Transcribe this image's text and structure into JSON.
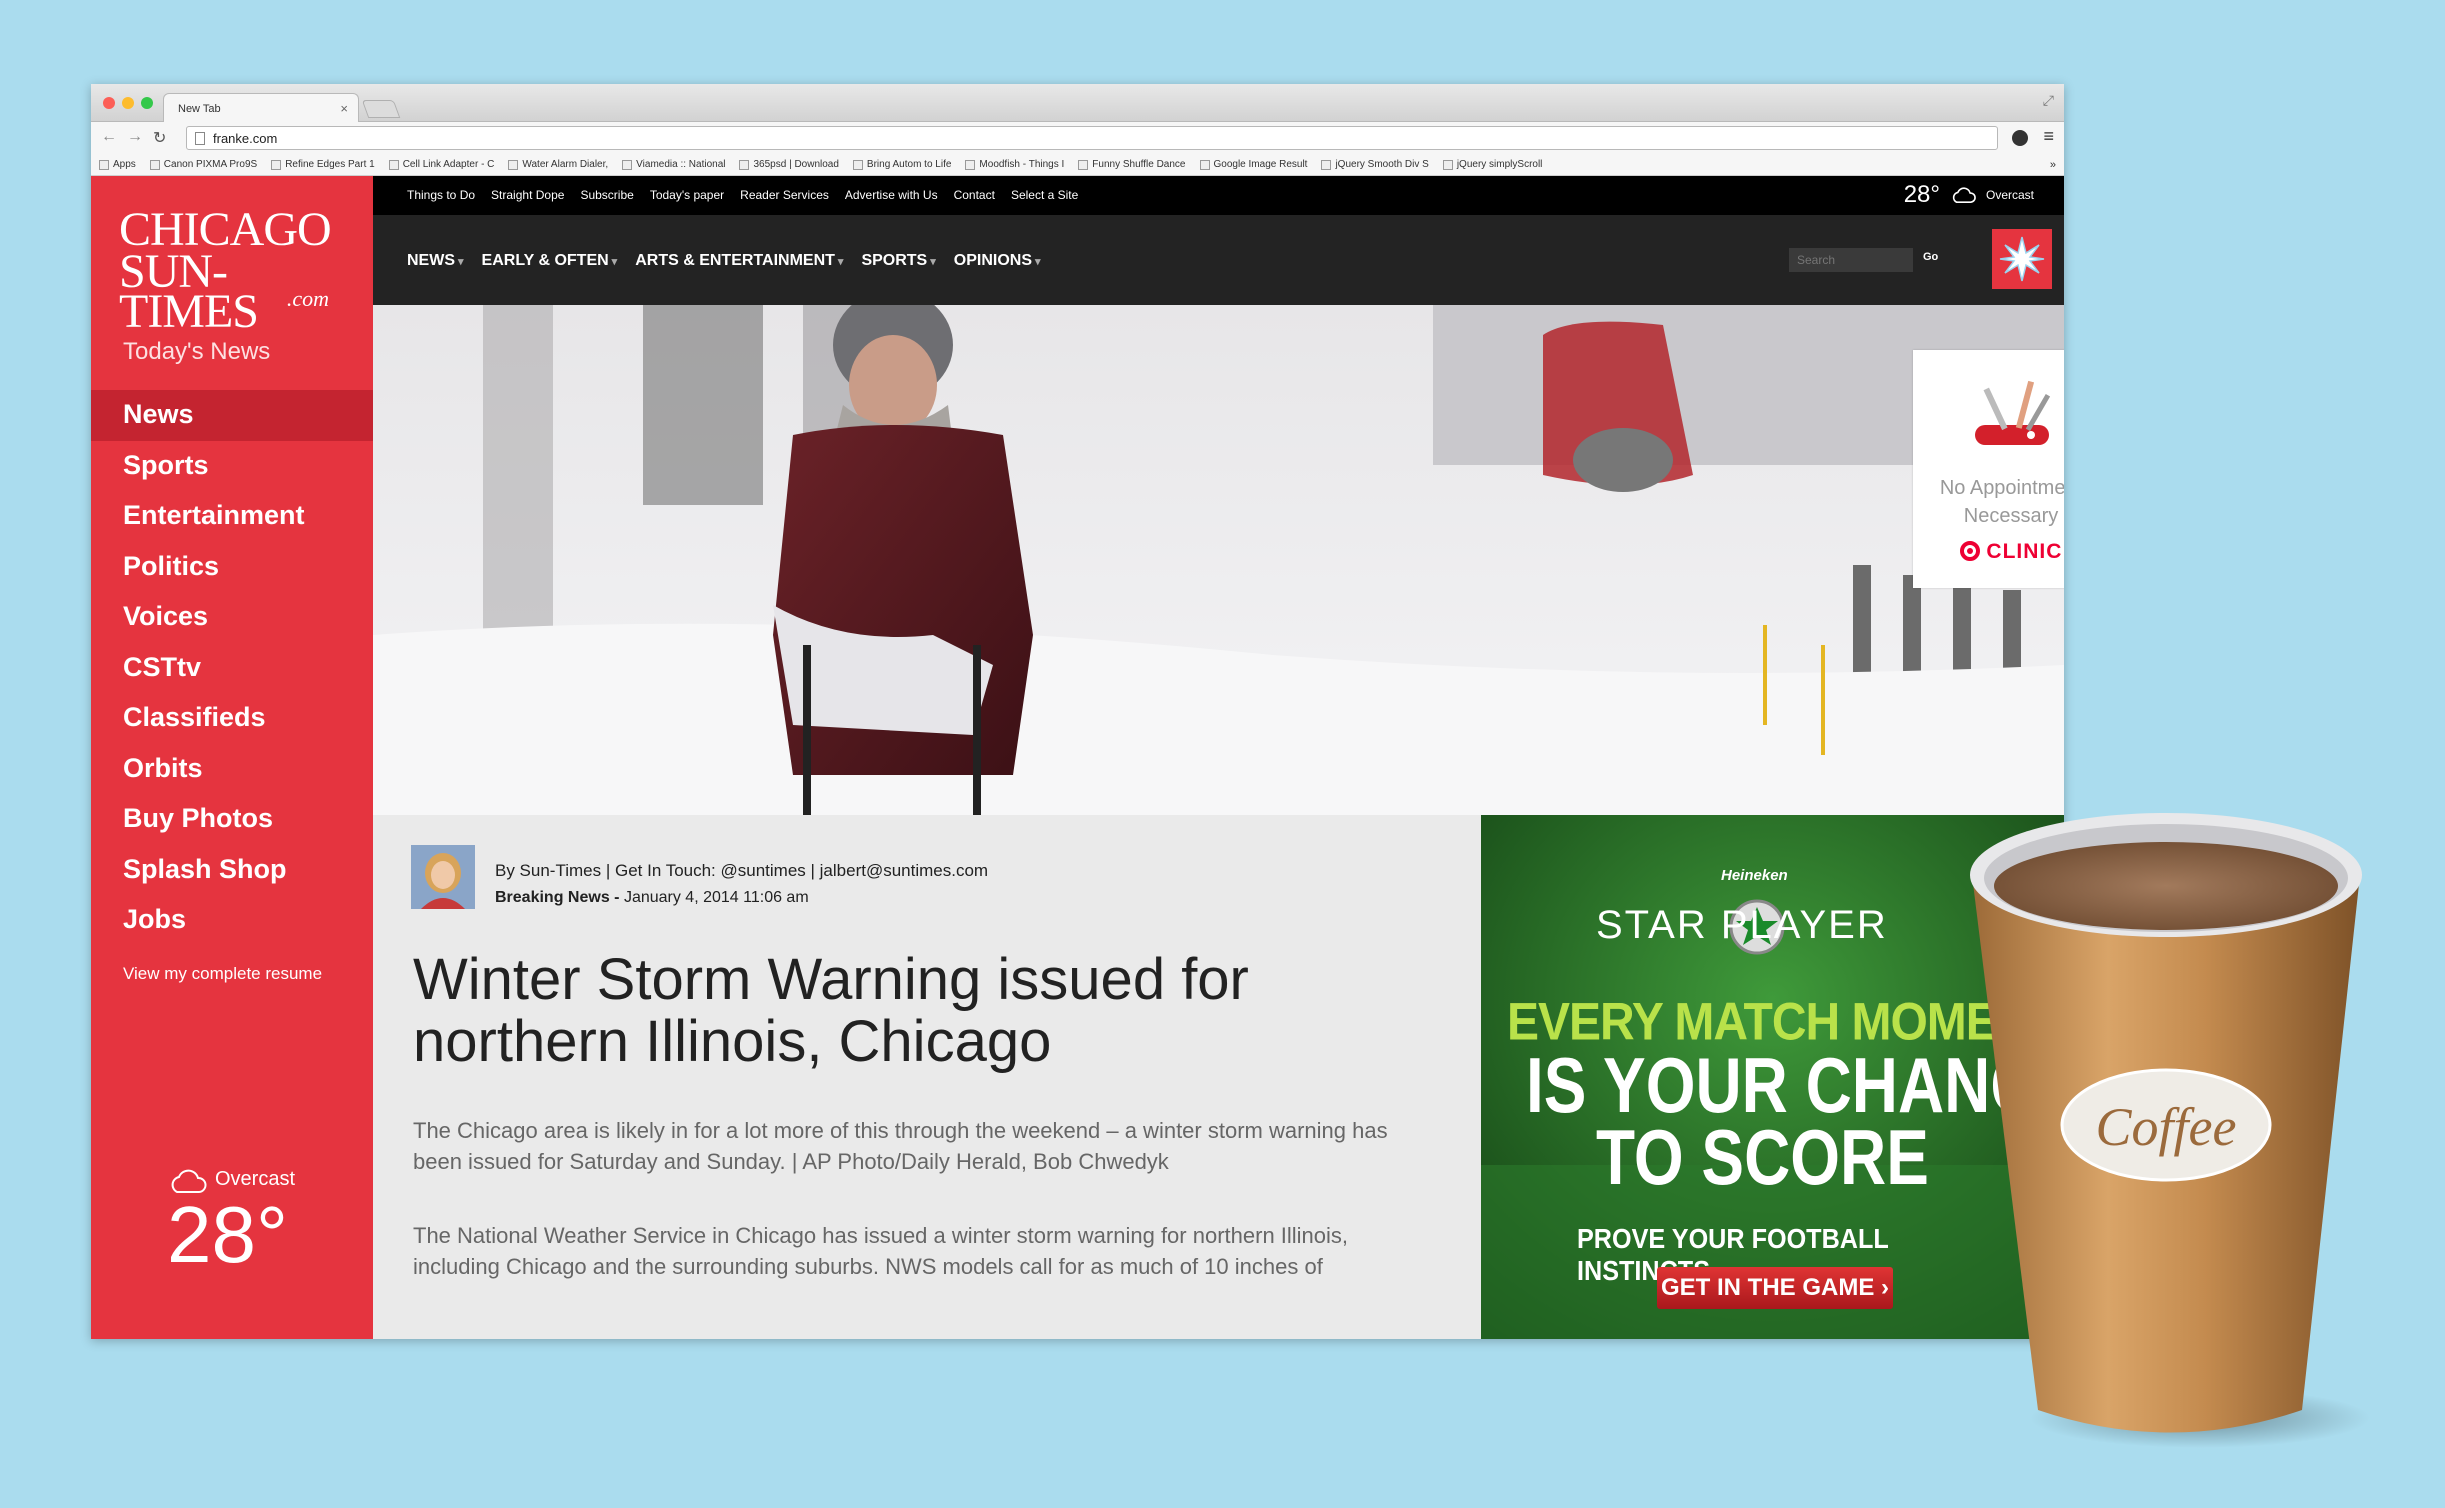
{
  "browser": {
    "tab_title": "New Tab",
    "url": "franke.com",
    "bookmarks": [
      "Apps",
      "Canon PIXMA Pro9S",
      "Refine Edges Part 1",
      "Cell Link Adapter - C",
      "Water Alarm Dialer, ",
      "Viamedia :: National",
      "365psd | Download",
      "Bring Autom to Life",
      "Moodfish - Things I",
      "Funny Shuffle Dance",
      "Google Image Result",
      "jQuery Smooth Div S",
      "jQuery simplyScroll"
    ],
    "bookmarks_more": "»"
  },
  "site": {
    "logo_line1": "CHICAGO",
    "logo_line2": "SUN-TIMES",
    "logo_line3": ".com",
    "todays_news": "Today's News",
    "side_nav": [
      "News",
      "Sports",
      "Entertainment",
      "Politics",
      "Voices",
      "CSTtv",
      "Classifieds",
      "Orbits",
      "Buy Photos",
      "Splash Shop",
      "Jobs"
    ],
    "resume_link": "View my complete resume",
    "weather": {
      "condition": "Overcast",
      "temp": "28°"
    },
    "top_links": [
      "Things to Do",
      "Straight Dope",
      "Subscribe",
      "Today's paper",
      "Reader Services",
      "Advertise with Us",
      "Contact",
      "Select a Site"
    ],
    "main_nav": [
      "NEWS",
      "EARLY & OFTEN",
      "ARTS & ENTERTAINMENT",
      "SPORTS",
      "OPINIONS"
    ],
    "search_placeholder": "Search",
    "go_label": "Go",
    "ad_card": {
      "line1": "No Appointment",
      "line2": "Necessary",
      "brand": "CLINIC",
      "close": "x"
    },
    "article": {
      "byline": "By Sun-Times | Get In Touch: @suntimes | jalbert@suntimes.com",
      "category": "Breaking News -",
      "date": "January 4, 2014 11:06 am",
      "headline_line1": "Winter Storm Warning issued for",
      "headline_line2": "northern Illinois, Chicago",
      "caption": "The Chicago area is likely in for a lot more of this through the weekend – a winter storm warning has been issued for Saturday and Sunday. | AP Photo/Daily Herald, Bob Chwedyk",
      "body": "The National Weather Service in Chicago has issued a winter storm warning for northern Illinois, including Chicago and the surrounding suburbs. NWS models call for as much of 10 inches of"
    },
    "banner": {
      "brand": "Heineken",
      "star_player": "STAR PLAYER",
      "line1": "EVERY MATCH MOMENT",
      "line2": "IS YOUR CHANC",
      "line3": "TO SCORE",
      "line4": "PROVE YOUR FOOTBALL INSTINCTS",
      "cta": "GET IN THE GAME ›"
    }
  },
  "cup_label": "Coffee",
  "colors": {
    "sidebar": "#e5343f",
    "sidebar_active": "#c42430",
    "background": "#aadcee",
    "topbar": "#000000",
    "nav": "#232323"
  }
}
